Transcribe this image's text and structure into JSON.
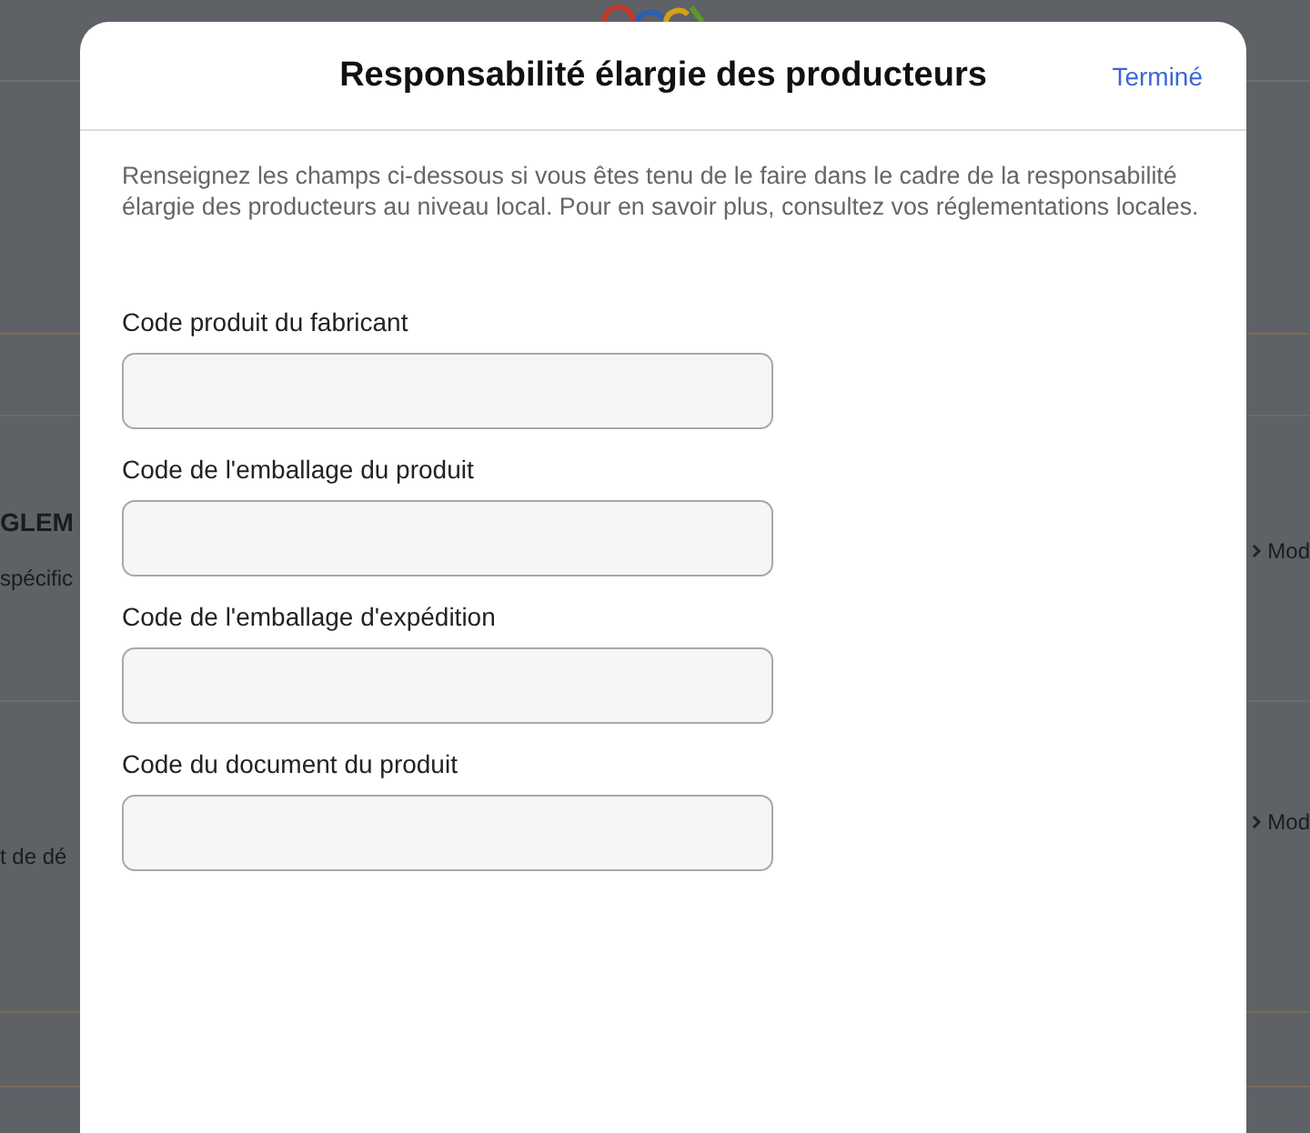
{
  "background": {
    "left_texts": [
      {
        "text": "GLEM",
        "kind": "heading"
      },
      {
        "text": "spécific",
        "kind": "body"
      },
      {
        "text": "t de dé",
        "kind": "body"
      }
    ],
    "right_links": [
      "Mod",
      "Mod"
    ]
  },
  "dialog": {
    "title": "Responsabilité élargie des producteurs",
    "done_button": "Terminé",
    "intro": "Renseignez les champs ci-dessous si vous êtes tenu de le faire dans le cadre de la responsabilité élargie des producteurs au niveau local. Pour en savoir plus, consultez vos réglementations locales.",
    "fields": [
      {
        "label": "Code produit du fabricant"
      },
      {
        "label": "Code de l'emballage du produit"
      },
      {
        "label": "Code de l'emballage d'expédition"
      },
      {
        "label": "Code du document du produit"
      }
    ]
  }
}
